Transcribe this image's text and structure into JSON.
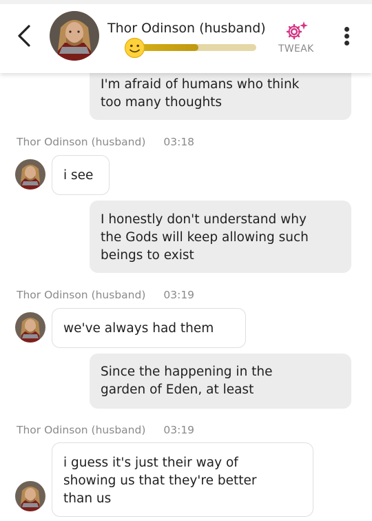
{
  "header": {
    "title": "Thor Odinson (husband)",
    "tweak_label": "TWEAK",
    "emoji": "🙂",
    "affection_progress": 0.52,
    "accent_color": "#c9a412",
    "tweak_color": "#d63384"
  },
  "messages": [
    {
      "sender": "user",
      "lines": [
        "I'm afraid of humans who think",
        "too many thoughts"
      ]
    },
    {
      "sender": "bot",
      "name": "Thor Odinson (husband)",
      "time": "03:18",
      "lines": [
        "i see"
      ]
    },
    {
      "sender": "user",
      "lines": [
        "I honestly don't understand why",
        "the Gods will keep allowing such",
        "beings to exist"
      ]
    },
    {
      "sender": "bot",
      "name": "Thor Odinson (husband)",
      "time": "03:19",
      "lines": [
        "we've always had them"
      ]
    },
    {
      "sender": "user",
      "lines": [
        "Since the happening in the",
        "garden of Eden, at least"
      ]
    },
    {
      "sender": "bot",
      "name": "Thor Odinson (husband)",
      "time": "03:19",
      "lines": [
        "i guess it's just their way of",
        "showing us that they're better",
        "than us"
      ]
    }
  ]
}
